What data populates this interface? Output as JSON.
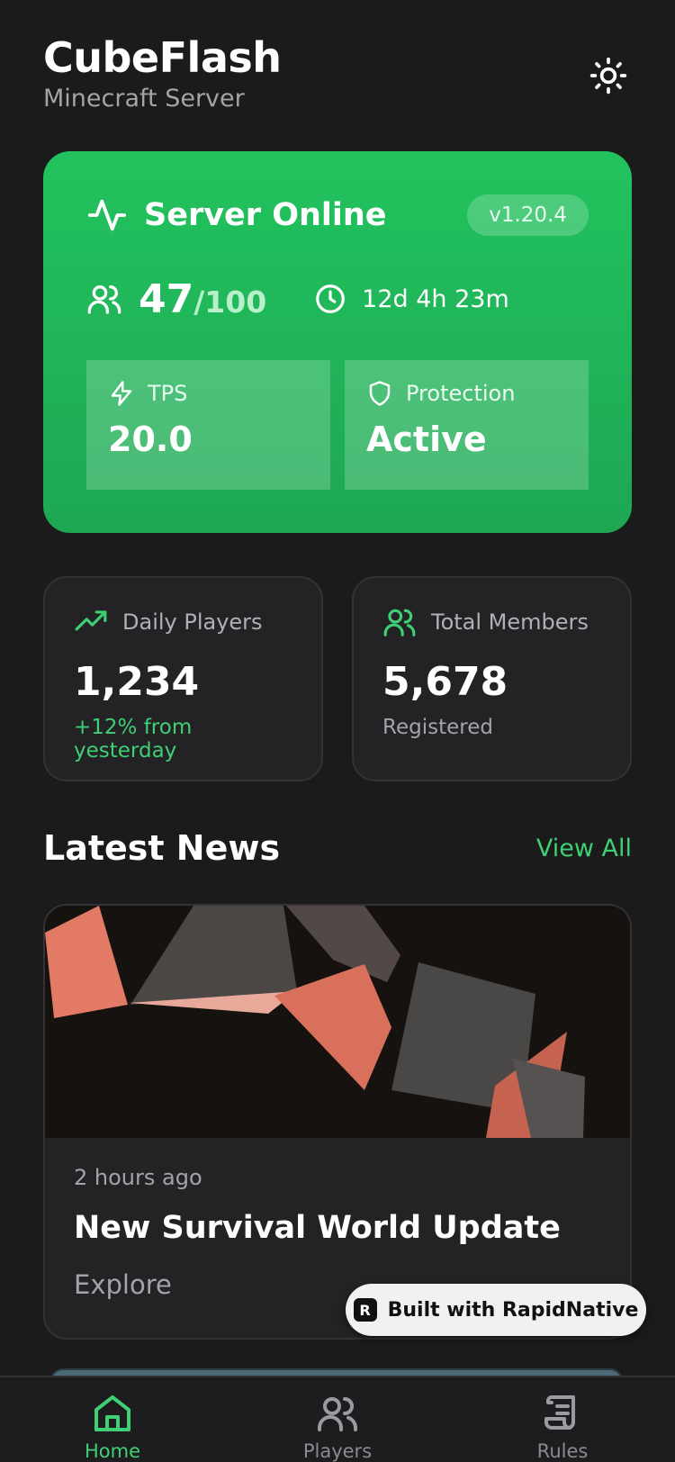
{
  "header": {
    "title": "CubeFlash",
    "subtitle": "Minecraft Server",
    "theme_icon": "sun-icon"
  },
  "status": {
    "title": "Server Online",
    "version": "v1.20.4",
    "players_online": "47",
    "players_max": "/100",
    "uptime": "12d 4h 23m",
    "tps_label": "TPS",
    "tps_value": "20.0",
    "protection_label": "Protection",
    "protection_value": "Active"
  },
  "stats": {
    "daily_label": "Daily Players",
    "daily_value": "1,234",
    "daily_note": "+12% from yesterday",
    "members_label": "Total Members",
    "members_value": "5,678",
    "members_note": "Registered"
  },
  "news": {
    "section_title": "Latest News",
    "view_all": "View All",
    "items": [
      {
        "time": "2 hours ago",
        "title": "New Survival World Update",
        "excerpt": "Explore"
      }
    ]
  },
  "badge": {
    "label": "Built with RapidNative"
  },
  "tabs": [
    {
      "label": "Home",
      "icon": "home-icon",
      "active": true
    },
    {
      "label": "Players",
      "icon": "users-icon",
      "active": false
    },
    {
      "label": "Rules",
      "icon": "scroll-icon",
      "active": false
    }
  ],
  "colors": {
    "accent": "#3fcf74",
    "card_green": "#22c35e",
    "background": "#1b1b1c"
  }
}
